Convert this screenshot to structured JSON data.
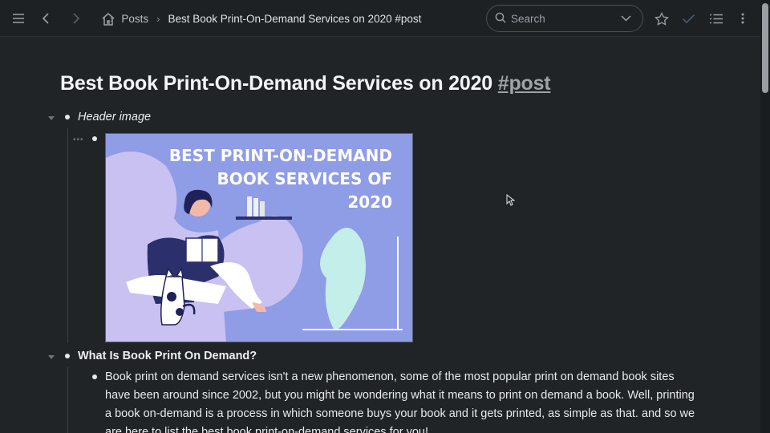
{
  "topbar": {
    "breadcrumb": {
      "section": "Posts",
      "current": "Best Book Print-On-Demand Services on 2020 #post"
    },
    "search": {
      "placeholder": "Search"
    },
    "icons": [
      "menu-icon",
      "back-icon",
      "forward-icon",
      "home-icon",
      "search-icon",
      "chevron-down-icon",
      "star-icon",
      "check-icon",
      "list-icon",
      "more-icon"
    ]
  },
  "page": {
    "title_text": "Best Book Print-On-Demand Services on 2020",
    "title_tag": "#post",
    "blocks": [
      {
        "label": "Header image"
      },
      {
        "label": "What Is Book Print On Demand?",
        "children": [
          "Book print on demand services isn't a new phenomenon, some of the most popular print on demand book sites have been around since 2002, but you might be wondering what it means to print on demand a book. Well, printing a book on-demand is a process in which someone buys your book and it gets printed, as simple as that. and so we are here to list the best book print-on-demand services for you!"
        ]
      }
    ],
    "header_image": {
      "line1": "BEST PRINT-ON-DEMAND",
      "line2": "BOOK SERVICES OF",
      "line3": "2020",
      "background_color": "#8f9ce6"
    }
  },
  "colors": {
    "background": "#202427",
    "text": "#e8eaec",
    "muted": "#9ea3a8"
  }
}
